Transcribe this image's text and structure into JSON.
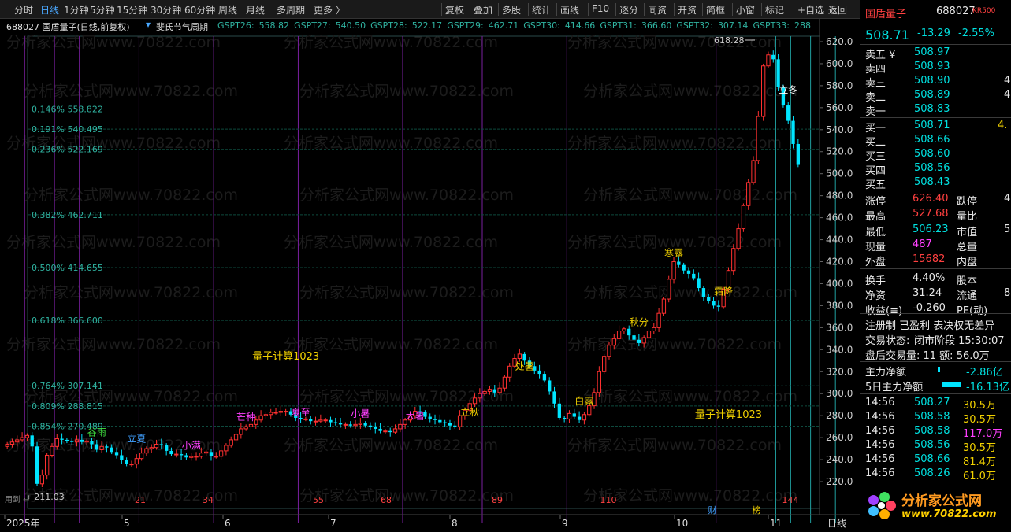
{
  "toolbar": {
    "periods": [
      "分时",
      "日线",
      "1分钟",
      "5分钟",
      "15分钟",
      "30分钟",
      "60分钟",
      "周线",
      "月线",
      "多周期",
      "更多 〉"
    ],
    "active_period": "日线",
    "tools": [
      "复权",
      "叠加",
      "多股",
      "统计",
      "画线",
      "F10",
      "逐分",
      "同资",
      "开资",
      "简框",
      "小窗",
      "标记",
      "+自选"
    ],
    "back": "返回"
  },
  "infobar": {
    "code_name": "688027 国盾量子(日线,前复权)",
    "indicator": "斐氏节气周期",
    "gspt": [
      {
        "name": "GSPT26",
        "value": "558.82"
      },
      {
        "name": "GSPT27",
        "value": "540.50"
      },
      {
        "name": "GSPT28",
        "value": "522.17"
      },
      {
        "name": "GSPT29",
        "value": "462.71"
      },
      {
        "name": "GSPT30",
        "value": "414.66"
      },
      {
        "name": "GSPT31",
        "value": "366.60"
      },
      {
        "name": "GSPT32",
        "value": "307.14"
      },
      {
        "name": "GSPT33",
        "value": "288"
      }
    ]
  },
  "watermark": "分析家公式网www.70822.com",
  "chart_data": {
    "type": "candlestick",
    "ylim": [
      210,
      625
    ],
    "y_ticks": [
      620,
      600,
      580,
      560,
      540,
      520,
      500,
      480,
      460,
      440,
      420,
      400,
      380,
      360,
      340,
      320,
      300,
      280,
      260,
      240,
      220
    ],
    "x_month_labels": [
      "2025年",
      "5",
      "6",
      "7",
      "8",
      "9",
      "10",
      "11"
    ],
    "fib_levels": [
      {
        "label": "0.146% 558.822",
        "value": 558.822
      },
      {
        "label": "0.191% 540.495",
        "value": 540.495
      },
      {
        "label": "0.236% 522.169",
        "value": 522.169
      },
      {
        "label": "0.382% 462.711",
        "value": 462.711
      },
      {
        "label": "0.500% 414.655",
        "value": 414.655
      },
      {
        "label": "0.618% 366.600",
        "value": 366.6
      },
      {
        "label": "0.764% 307.141",
        "value": 307.141
      },
      {
        "label": "0.809% 288.815",
        "value": 288.815
      },
      {
        "label": "0.854% 270.489",
        "value": 270.489
      }
    ],
    "solar_terms": [
      {
        "name": "谷雨",
        "day": 18,
        "price": 262,
        "color": "#40e040"
      },
      {
        "name": "立夏",
        "day": 26,
        "price": 256,
        "color": "#40a0ff"
      },
      {
        "name": "小满",
        "day": 37,
        "price": 250,
        "color": "#ff40ff"
      },
      {
        "name": "芒种",
        "day": 48,
        "price": 276,
        "color": "#ff40ff"
      },
      {
        "name": "夏至",
        "day": 59,
        "price": 280,
        "color": "#ff40ff"
      },
      {
        "name": "小暑",
        "day": 71,
        "price": 279,
        "color": "#ff40ff"
      },
      {
        "name": "大暑",
        "day": 82,
        "price": 277,
        "color": "#ff40ff"
      },
      {
        "name": "立秋",
        "day": 93,
        "price": 280,
        "color": "#f0d000"
      },
      {
        "name": "处暑",
        "day": 104,
        "price": 322,
        "color": "#f0d000"
      },
      {
        "name": "白露",
        "day": 116,
        "price": 290,
        "color": "#f0d000"
      },
      {
        "name": "秋分",
        "day": 127,
        "price": 362,
        "color": "#f0d000"
      },
      {
        "name": "寒露",
        "day": 134,
        "price": 425,
        "color": "#f0d000"
      },
      {
        "name": "霜降",
        "day": 144,
        "price": 390,
        "color": "#f0d000"
      },
      {
        "name": "立冬",
        "day": 157,
        "price": 573,
        "color": "#ffffff"
      }
    ],
    "labels": [
      {
        "text": "量子计算1023",
        "day": 56,
        "price": 331
      },
      {
        "text": "量子计算1023",
        "day": 145,
        "price": 278
      }
    ],
    "high_label": "618.28",
    "low_label": "211.03",
    "bottom_counts": [
      "21",
      "34",
      "55",
      "68",
      "89",
      "110",
      "144"
    ],
    "bottom_left_text": "用到 ←",
    "badges": [
      "财",
      "榜"
    ],
    "x_axis_mode": "日线",
    "prices": [
      254,
      256,
      258,
      260,
      262,
      252,
      218,
      226,
      244,
      252,
      259,
      258,
      257,
      256,
      258,
      256,
      257,
      254,
      249,
      252,
      251,
      247,
      244,
      240,
      236,
      236,
      241,
      246,
      250,
      251,
      254,
      253,
      248,
      245,
      245,
      244,
      242,
      243,
      243,
      246,
      247,
      243,
      243,
      248,
      253,
      258,
      263,
      268,
      270,
      272,
      276,
      280,
      281,
      283,
      283,
      284,
      284,
      281,
      278,
      277,
      277,
      275,
      275,
      276,
      276,
      274,
      273,
      272,
      272,
      271,
      272,
      273,
      271,
      270,
      268,
      266,
      266,
      265,
      268,
      272,
      276,
      280,
      284,
      283,
      279,
      277,
      276,
      274,
      273,
      271,
      270,
      280,
      285,
      291,
      296,
      300,
      302,
      304,
      301,
      305,
      315,
      325,
      332,
      336,
      330,
      325,
      321,
      318,
      312,
      302,
      291,
      278,
      277,
      282,
      279,
      276,
      281,
      289,
      301,
      320,
      334,
      344,
      350,
      357,
      359,
      353,
      349,
      346,
      351,
      357,
      360,
      373,
      386,
      404,
      420,
      417,
      412,
      409,
      405,
      396,
      388,
      384,
      380,
      379,
      395,
      412,
      432,
      450,
      471,
      492,
      512,
      552,
      598,
      608,
      604,
      579,
      562,
      548,
      527,
      508
    ]
  },
  "quote": {
    "name": "国盾量子",
    "code": "688027",
    "tag": "KR500",
    "price": "508.71",
    "change": "-13.29",
    "change_pct": "-2.55%",
    "asks": [
      {
        "label": "卖五 ¥",
        "price": "508.97"
      },
      {
        "label": "卖四",
        "price": "508.93"
      },
      {
        "label": "卖三",
        "price": "508.90"
      },
      {
        "label": "卖二",
        "price": "508.89"
      },
      {
        "label": "卖一",
        "price": "508.83"
      }
    ],
    "bids": [
      {
        "label": "买一",
        "price": "508.71"
      },
      {
        "label": "买二",
        "price": "508.66"
      },
      {
        "label": "买三",
        "price": "508.60"
      },
      {
        "label": "买四",
        "price": "508.56"
      },
      {
        "label": "买五",
        "price": "508.43"
      }
    ],
    "ask_vol_partial": "4",
    "bid_vol_partial": "4.",
    "stats": [
      {
        "k1": "涨停",
        "v1": "626.40",
        "c1": "red",
        "k2": "跌停",
        "v2": "4"
      },
      {
        "k1": "最高",
        "v1": "527.68",
        "c1": "red",
        "k2": "量比",
        "v2": ""
      },
      {
        "k1": "最低",
        "v1": "506.23",
        "c1": "green",
        "k2": "市值",
        "v2": "5"
      },
      {
        "k1": "现量",
        "v1": "487",
        "c1": "magenta",
        "k2": "总量",
        "v2": ""
      },
      {
        "k1": "外盘",
        "v1": "15682",
        "c1": "red",
        "k2": "内盘",
        "v2": ""
      },
      {
        "k1": "换手",
        "v1": "4.40%",
        "c1": "white",
        "k2": "股本",
        "v2": ""
      },
      {
        "k1": "净资",
        "v1": "31.24",
        "c1": "white",
        "k2": "流通",
        "v2": "8"
      },
      {
        "k1": "收益(≡)",
        "v1": "-0.260",
        "c1": "white",
        "k2": "PE(动)",
        "v2": ""
      }
    ],
    "reg": "注册制 已盈利 表决权无差异",
    "trade_status_label": "交易状态:",
    "trade_status": "闭市阶段 15:30:07",
    "after_hours": "盘后交易量: 11 额: 56.0万",
    "main_flow_label": "主力净额",
    "main_flow": "-2.86亿",
    "main_flow5_label": "5日主力净额",
    "main_flow5": "-16.13亿",
    "ticks": [
      {
        "time": "14:56",
        "price": "508.27",
        "vol": "30.5万",
        "vc": "yellow"
      },
      {
        "time": "14:56",
        "price": "508.58",
        "vol": "30.5万",
        "vc": "yellow"
      },
      {
        "time": "14:56",
        "price": "508.58",
        "vol": "117.0万",
        "vc": "magenta"
      },
      {
        "time": "14:56",
        "price": "508.56",
        "vol": "30.5万",
        "vc": "yellow"
      },
      {
        "time": "14:56",
        "price": "508.66",
        "vol": "81.4万",
        "vc": "yellow"
      },
      {
        "time": "14:56",
        "price": "508.26",
        "vol": "61.0万",
        "vc": "yellow"
      }
    ],
    "logo_text": "分析家公式网",
    "logo_url": "www.70822.com"
  }
}
